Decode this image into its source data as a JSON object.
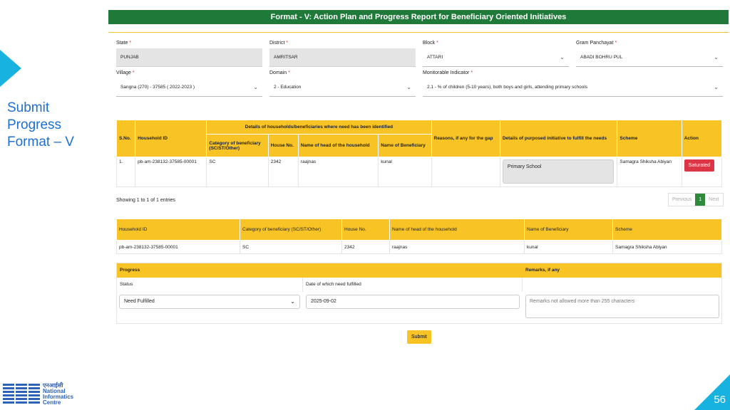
{
  "slide": {
    "title_line1": "Submit",
    "title_line2": "Progress",
    "title_line3": "Format – V",
    "page_number": "56"
  },
  "logo": {
    "hindi": "एनआईसी",
    "line1": "National",
    "line2": "Informatics",
    "line3": "Centre"
  },
  "form": {
    "header": "Format - V: Action Plan and Progress Report for Beneficiary Oriented Initiatives",
    "fields": {
      "state": {
        "label": "State",
        "value": "PUNJAB"
      },
      "district": {
        "label": "District",
        "value": "AMRITSAR"
      },
      "block": {
        "label": "Block",
        "value": "ATTARI"
      },
      "gram": {
        "label": "Gram Panchayat",
        "value": "ABADI BOHRU PUL"
      },
      "village": {
        "label": "Village",
        "value": "Sangna (270) - 37585 ( 2022-2023 )"
      },
      "domain": {
        "label": "Domain",
        "value": "2 - Education"
      },
      "indicator": {
        "label": "Monitorable Indicator",
        "value": "2.1 - % of children (5-10 years), both boys and girls, attending primary schools"
      }
    }
  },
  "table1": {
    "headers": {
      "sno": "S.No.",
      "hh": "Household ID",
      "group": "Details of households/beneficiaries where need has been identified",
      "cat": "Category of beneficiary (SC/ST/Other)",
      "house": "House No.",
      "head": "Name of head of the household",
      "ben": "Name of Beneficiary",
      "reason": "Reasons, if any for the gap",
      "details": "Details of purposed initiative to fulfill the needs",
      "scheme": "Scheme",
      "action": "Action"
    },
    "row": {
      "sno": "1.",
      "hh": "pb-am-238132-37585-00001",
      "cat": "SC",
      "house": "2342",
      "head": "raajnas",
      "ben": "kunal",
      "reason": "",
      "details": "Primary School",
      "scheme": "Samagra Shiksha Abiyan",
      "action": "Saturated"
    }
  },
  "showing": "Showing 1 to 1 of 1 entries",
  "pager": {
    "prev": "Previous",
    "page": "1",
    "next": "Next"
  },
  "table2": {
    "headers": {
      "hh": "Household ID",
      "cat": "Category of beneficiary (SC/ST/Other)",
      "house": "House No.",
      "head": "Name of head of the household",
      "ben": "Name of Beneficiary",
      "scheme": "Scheme"
    },
    "row": {
      "hh": "pb-am-238132-37585-00001",
      "cat": "SC",
      "house": "2342",
      "head": "raajnas",
      "ben": "kunal",
      "scheme": "Samagra Shiksha Abiyan"
    }
  },
  "progress": {
    "head": "Progress",
    "remarks_head": "Remarks, if any",
    "status_label": "Status",
    "date_label": "Date of which need fulfilled",
    "status_value": "Need Fulfilled",
    "date_value": "2025-09-02",
    "remarks_placeholder": "Remarks not allowed more than 255 characters"
  },
  "submit": "Submit"
}
